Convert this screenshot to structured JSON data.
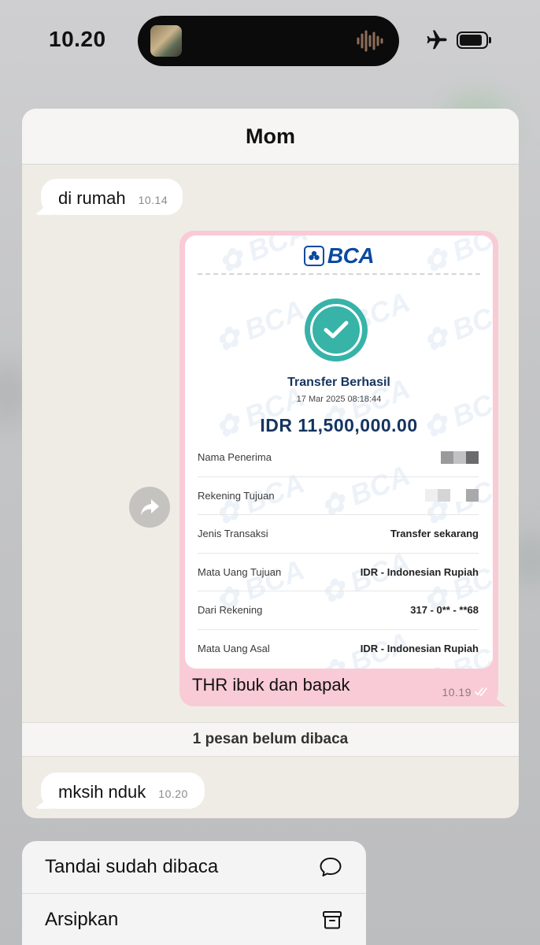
{
  "status_bar": {
    "time": "10.20",
    "icons": [
      "island-avatar",
      "voice-waveform-icon",
      "airplane-mode-icon",
      "battery-icon"
    ]
  },
  "chat": {
    "title": "Mom",
    "messages": [
      {
        "direction": "incoming",
        "text": "di rumah",
        "time": "10.14"
      },
      {
        "direction": "outgoing",
        "caption": "THR ibuk dan bapak",
        "time": "10.19",
        "status": "read-ticks",
        "attachment": {
          "bank_logo": "BCA",
          "title": "Transfer Berhasil",
          "datetime": "17 Mar 2025 08:18:44",
          "amount": "IDR 11,500,000.00",
          "rows": [
            {
              "label": "Nama Penerima",
              "value": "",
              "redacted": true
            },
            {
              "label": "Rekening Tujuan",
              "value": "",
              "redacted": true
            },
            {
              "label": "Jenis Transaksi",
              "value": "Transfer sekarang"
            },
            {
              "label": "Mata Uang Tujuan",
              "value": "IDR - Indonesian Rupiah"
            },
            {
              "label": "Dari Rekening",
              "value": "317 - 0** - **68"
            },
            {
              "label": "Mata Uang Asal",
              "value": "IDR - Indonesian Rupiah"
            }
          ]
        }
      },
      {
        "direction": "incoming",
        "text": "mksih nduk",
        "time": "10.20"
      }
    ],
    "unread_banner": "1 pesan belum dibaca"
  },
  "context_menu": {
    "items": [
      {
        "label": "Tandai sudah dibaca",
        "icon": "chat-bubble-icon"
      },
      {
        "label": "Arsipkan",
        "icon": "archive-box-icon"
      }
    ]
  },
  "colors": {
    "outgoing_bubble": "#f9cbd6",
    "chat_background": "#efece6",
    "bca_blue": "#0a4a9f",
    "success_teal": "#37b3a8"
  }
}
